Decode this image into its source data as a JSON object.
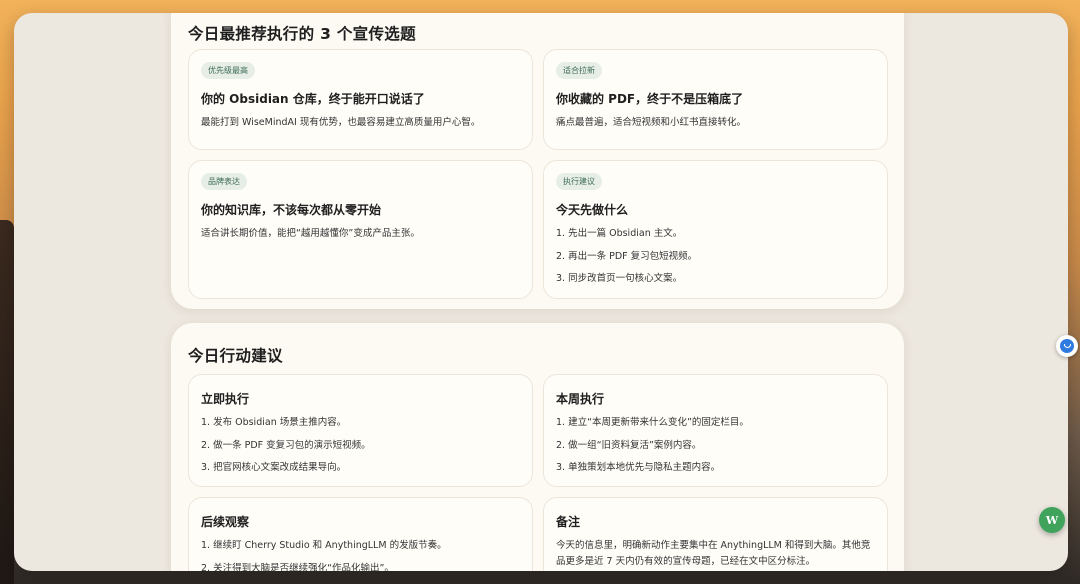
{
  "recommend": {
    "title": "今日最推荐执行的 3 个宣传选题",
    "cards": [
      {
        "badge": "优先级最高",
        "title": "你的 Obsidian 仓库，终于能开口说话了",
        "desc": "最能打到 WiseMindAI 现有优势，也最容易建立高质量用户心智。"
      },
      {
        "badge": "适合拉新",
        "title": "你收藏的 PDF，终于不是压箱底了",
        "desc": "痛点最普遍，适合短视频和小红书直接转化。"
      },
      {
        "badge": "品牌表达",
        "title": "你的知识库，不该每次都从零开始",
        "desc": "适合讲长期价值，能把“越用越懂你”变成产品主张。"
      },
      {
        "badge": "执行建议",
        "title": "今天先做什么",
        "items": [
          "1. 先出一篇 Obsidian 主文。",
          "2. 再出一条 PDF 复习包短视频。",
          "3. 同步改首页一句核心文案。"
        ]
      }
    ]
  },
  "actions": {
    "title": "今日行动建议",
    "cards": [
      {
        "title": "立即执行",
        "items": [
          "1. 发布 Obsidian 场景主推内容。",
          "2. 做一条 PDF 变复习包的演示短视频。",
          "3. 把官网核心文案改成结果导向。"
        ]
      },
      {
        "title": "本周执行",
        "items": [
          "1. 建立“本周更新带来什么变化”的固定栏目。",
          "2. 做一组“旧资料复活”案例内容。",
          "3. 单独策划本地优先与隐私主题内容。"
        ]
      },
      {
        "title": "后续观察",
        "items": [
          "1. 继续盯 Cherry Studio 和 AnythingLLM 的发版节奏。",
          "2. 关注得到大脑是否继续强化“作品化输出”。"
        ]
      },
      {
        "title": "备注",
        "desc": "今天的信息里，明确新动作主要集中在 AnythingLLM 和得到大脑。其他竞品更多是近 7 天内仍有效的宣传母题，已经在文中区分标注。"
      }
    ]
  },
  "floating": {
    "wm_label": "W"
  },
  "colors": {
    "badge_bg": "#e6eee7",
    "badge_text": "#3d6b56",
    "panel_bg": "#fdfaf3",
    "accent_green": "#3fa35c",
    "accent_blue": "#2f7be0"
  }
}
